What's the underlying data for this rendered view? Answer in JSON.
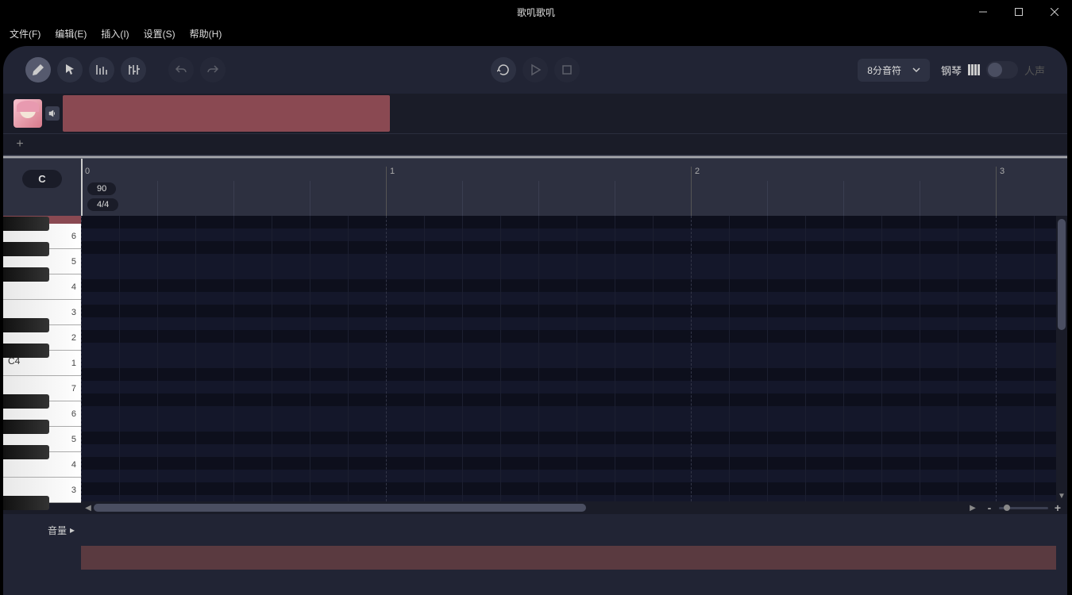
{
  "app": {
    "title": "歌叽歌叽"
  },
  "menubar": {
    "file": "文件(F)",
    "edit": "编辑(E)",
    "insert": "插入(I)",
    "settings": "设置(S)",
    "help": "帮助(H)"
  },
  "toolbar": {
    "pencil": "pencil",
    "pointer": "pointer",
    "pitch": "pitch-edit",
    "params": "params-edit",
    "undo": "undo",
    "redo": "redo",
    "loop": "loop",
    "play": "play",
    "stop": "stop"
  },
  "quantize": {
    "value": "8分音符"
  },
  "mode": {
    "piano": "钢琴",
    "vocal": "人声"
  },
  "ruler": {
    "bars": [
      "0",
      "1",
      "2",
      "3"
    ],
    "key": "C",
    "tempo": "90",
    "timesig": "4/4"
  },
  "piano": {
    "center_label": "C4",
    "white_numbers_top": [
      "6",
      "5",
      "4",
      "3",
      "2",
      "1"
    ],
    "white_numbers_bot": [
      "7",
      "6",
      "5",
      "4",
      "3"
    ]
  },
  "params": {
    "volume": "音量"
  }
}
